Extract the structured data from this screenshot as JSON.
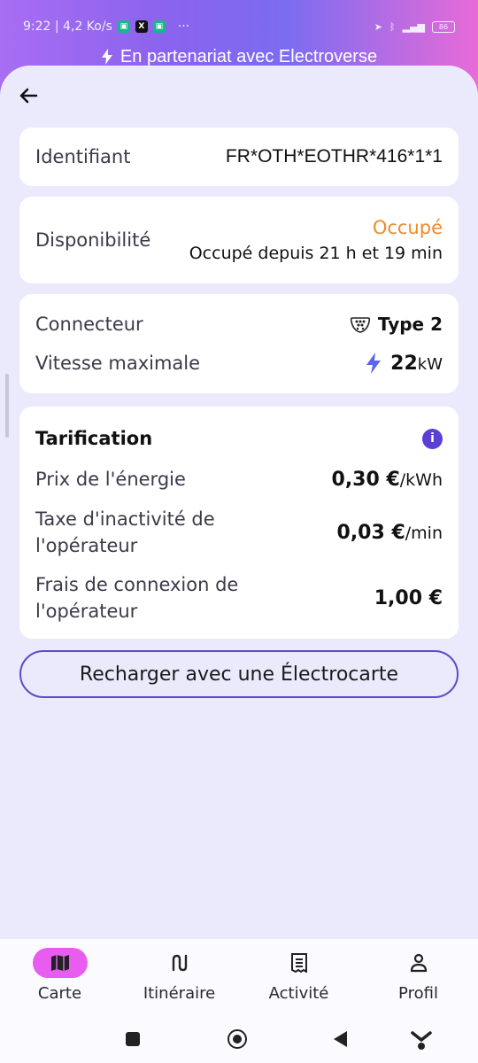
{
  "status_bar": {
    "time_speed": "9:22 | 4,2 Ko/s",
    "battery": "86",
    "dots": "···"
  },
  "banner": {
    "text": "En partenariat avec Electroverse"
  },
  "identifier": {
    "label": "Identifiant",
    "value": "FR*OTH*EOTHR*416*1*1"
  },
  "availability": {
    "label": "Disponibilité",
    "status": "Occupé",
    "detail": "Occupé depuis 21 h et 19 min",
    "status_color": "#f08a2c"
  },
  "connector": {
    "label": "Connecteur",
    "value": "Type 2",
    "icon": "type2-plug-icon"
  },
  "speed": {
    "label": "Vitesse maximale",
    "value": "22",
    "unit": "kW",
    "icon": "lightning-icon"
  },
  "pricing": {
    "title": "Tarification",
    "energy": {
      "label": "Prix de l'énergie",
      "value": "0,30 €",
      "unit": "/kWh"
    },
    "idle": {
      "label_line1": "Taxe d'inactivité de",
      "label_line2": "l'opérateur",
      "value": "0,03 €",
      "unit": "/min"
    },
    "connection": {
      "label_line1": "Frais de connexion de",
      "label_line2": "l'opérateur",
      "value": "1,00 €"
    }
  },
  "cta": {
    "label": "Recharger avec une Électrocarte"
  },
  "nav": [
    {
      "label": "Carte",
      "icon": "map-icon",
      "active": true
    },
    {
      "label": "Itinéraire",
      "icon": "route-icon",
      "active": false
    },
    {
      "label": "Activité",
      "icon": "receipt-icon",
      "active": false
    },
    {
      "label": "Profil",
      "icon": "person-icon",
      "active": false
    }
  ],
  "colors": {
    "accent": "#5b4bc9",
    "nav_active": "#e85cf0",
    "background": "#ebeafc"
  }
}
